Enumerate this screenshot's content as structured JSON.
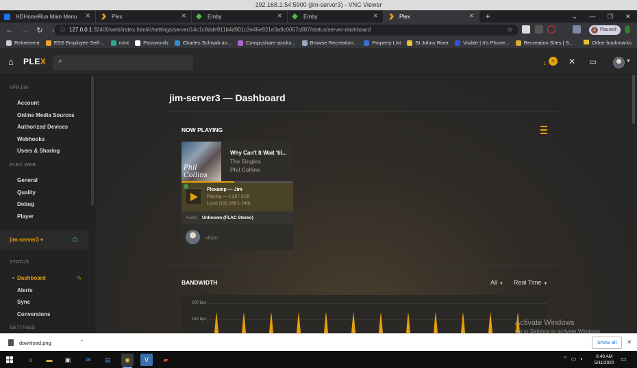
{
  "vnc": {
    "title": "192.168.1.54:5900 (jim-server3) - VNC Viewer"
  },
  "tabs": [
    {
      "label": "HDHomeRun Main Menu",
      "color": "#1a73e8"
    },
    {
      "label": "Plex",
      "color": "#e5a00d"
    },
    {
      "label": "Emby",
      "color": "#52b54b"
    },
    {
      "label": "Emby",
      "color": "#52b54b"
    },
    {
      "label": "Plex",
      "color": "#e5a00d"
    }
  ],
  "browser": {
    "url_host": "127.0.0.1",
    "url_rest": ":32400/web/index.html#!/settings/server/14c1c8dde911b4d901c3e46e921e3a9c0057c887/status/server-dashboard",
    "profile_initial": "J",
    "profile_status": "Paused"
  },
  "bookmarks": [
    {
      "label": "Retirement",
      "color": "#cccccc"
    },
    {
      "label": "ESS Employee Self-...",
      "color": "#f0a030"
    },
    {
      "label": "mint",
      "color": "#2ca58d"
    },
    {
      "label": "Passwords",
      "color": "#ffffff"
    },
    {
      "label": "Charles Schwab an...",
      "color": "#2d8fd5"
    },
    {
      "label": "Compushare stocks...",
      "color": "#b066d0"
    },
    {
      "label": "Browse Recreation...",
      "color": "#9aa8c0"
    },
    {
      "label": "Property List",
      "color": "#3a6fd0"
    },
    {
      "label": "St Johns River",
      "color": "#e8c030"
    },
    {
      "label": "Visible | It's Phone...",
      "color": "#3050e0"
    },
    {
      "label": "Recreation Sites | S...",
      "color": "#d8b030"
    }
  ],
  "other_bookmarks": "Other bookmarks",
  "plex": {
    "logo_a": "PLE",
    "logo_b": "X",
    "notif_count": "1"
  },
  "sidebar": {
    "sections": {
      "account": "VFRJIM",
      "web": "PLEX WEB",
      "status": "STATUS",
      "settings": "SETTINGS"
    },
    "account_items": [
      "Account",
      "Online Media Sources",
      "Authorized Devices",
      "Webhooks",
      "Users & Sharing"
    ],
    "web_items": [
      "General",
      "Quality",
      "Debug",
      "Player"
    ],
    "server": "jim-server3",
    "status_items": [
      "Dashboard",
      "Alerts",
      "Sync",
      "Conversions"
    ]
  },
  "main": {
    "title": "jim-server3 — Dashboard",
    "now_playing": "NOW PLAYING",
    "track": "Why Can't It Wait 'til...",
    "album": "The Singles",
    "artist": "Phil Collins",
    "art_text": "Phil Collins",
    "progress": 0.47,
    "player_name": "Plexamp — Jim",
    "player_state": "Playing — 1:28 / 3:09",
    "player_loc": "Local (192.168.1.240)",
    "audio_label": "Audio",
    "audio_value": "Unknown (FLAC Stereo)",
    "user": "vfrjim",
    "bandwidth": "BANDWIDTH",
    "filter_all": "All",
    "filter_time": "Real Time",
    "y_labels": [
      "200 bps",
      "160 bps"
    ]
  },
  "windows_watermark": {
    "line1": "Activate Windows",
    "line2": "Go to Settings to activate Windows."
  },
  "download": {
    "file": "download.png",
    "show_all": "Show all"
  },
  "taskbar": {
    "time": "6:49 AM",
    "date": "5/11/2020"
  }
}
